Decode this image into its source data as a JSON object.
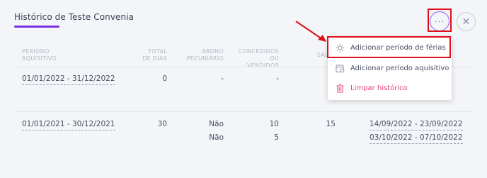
{
  "header": {
    "title": "Histórico de Teste Convenia",
    "more_label": "···",
    "close_label": "✕"
  },
  "table": {
    "headers": {
      "periodo": [
        "PERÍODO",
        "AQUISITIVO"
      ],
      "total": [
        "TOTAL",
        "DE DIAS"
      ],
      "abono": [
        "ABONO",
        "PECUNIÁRIO"
      ],
      "concedidos": [
        "CONCEDIDOS OU",
        "VENDIDOS"
      ],
      "saldo": "SAL"
    },
    "rows": [
      {
        "periodo": "01/01/2022 - 31/12/2022",
        "total": "0",
        "abono": "-",
        "concedidos": "-",
        "extra": "-"
      },
      {
        "periodo": "01/01/2021 - 30/12/2021",
        "total": "30",
        "abono": [
          "Não",
          "Não"
        ],
        "concedidos": [
          "10",
          "5"
        ],
        "saldo": "15",
        "ferias": [
          "14/09/2022 - 23/09/2022",
          "03/10/2022 - 07/10/2022"
        ]
      }
    ]
  },
  "menu": {
    "items": [
      {
        "label": "Adicionar período de férias",
        "icon": "sun-icon"
      },
      {
        "label": "Adicionar período aquisitivo",
        "icon": "calendar-icon"
      },
      {
        "label": "Limpar histórico",
        "icon": "trash-icon"
      }
    ]
  },
  "colors": {
    "accent": "#7a2ee6",
    "danger": "#e0457b",
    "annotation": "#e0101a"
  }
}
